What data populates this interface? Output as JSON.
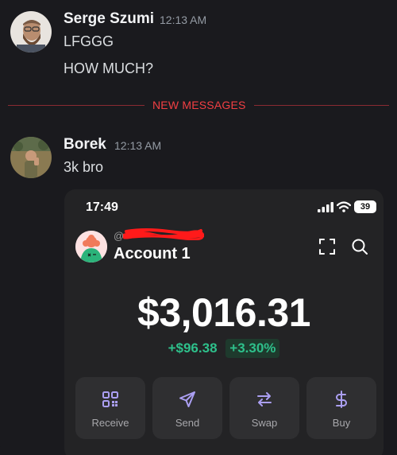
{
  "messages": [
    {
      "author": "Serge Szumi",
      "time": "12:13 AM",
      "lines": [
        "LFGGG",
        "HOW MUCH?"
      ],
      "avatar_icon": "user-avatar-bearded-man"
    },
    {
      "author": "Borek",
      "time": "12:13 AM",
      "lines": [
        "3k bro"
      ],
      "avatar_icon": "user-avatar-man-in-field"
    }
  ],
  "divider": {
    "label": "NEW MESSAGES",
    "color": "#f23f43"
  },
  "screenshot": {
    "status": {
      "time": "17:49",
      "battery": "39"
    },
    "account": {
      "handle_prefix": "@",
      "name": "Account 1",
      "avatar_icon": "account-avatar-green-creature",
      "redaction_color": "#ff1a1a"
    },
    "balance": "$3,016.31",
    "change": {
      "amount": "+$96.38",
      "percent": "+3.30%",
      "color": "#2ec08b"
    },
    "actions": [
      {
        "label": "Receive",
        "icon": "qr-code-icon"
      },
      {
        "label": "Send",
        "icon": "send-icon"
      },
      {
        "label": "Swap",
        "icon": "swap-icon"
      },
      {
        "label": "Buy",
        "icon": "dollar-icon"
      }
    ],
    "accent": "#ab9ff2"
  }
}
